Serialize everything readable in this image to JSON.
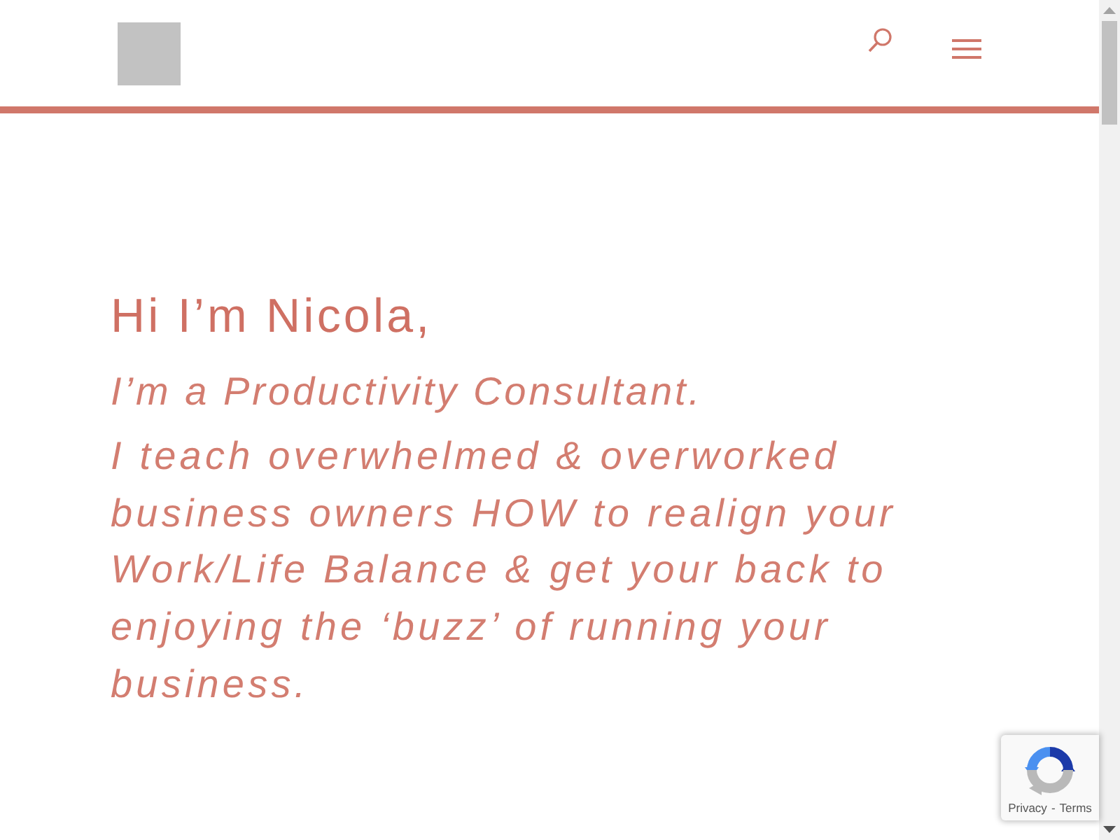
{
  "hero": {
    "greeting": "Hi I’m Nicola,",
    "tagline": "I’m a Productivity Consultant.",
    "description": "I teach overwhelmed & overworked business owners HOW to realign your Work/Life Balance & get your back to enjoying the ‘buzz’ of running your business."
  },
  "recaptcha": {
    "privacy_link": "Privacy",
    "separator": "-",
    "terms_link": "Terms"
  }
}
